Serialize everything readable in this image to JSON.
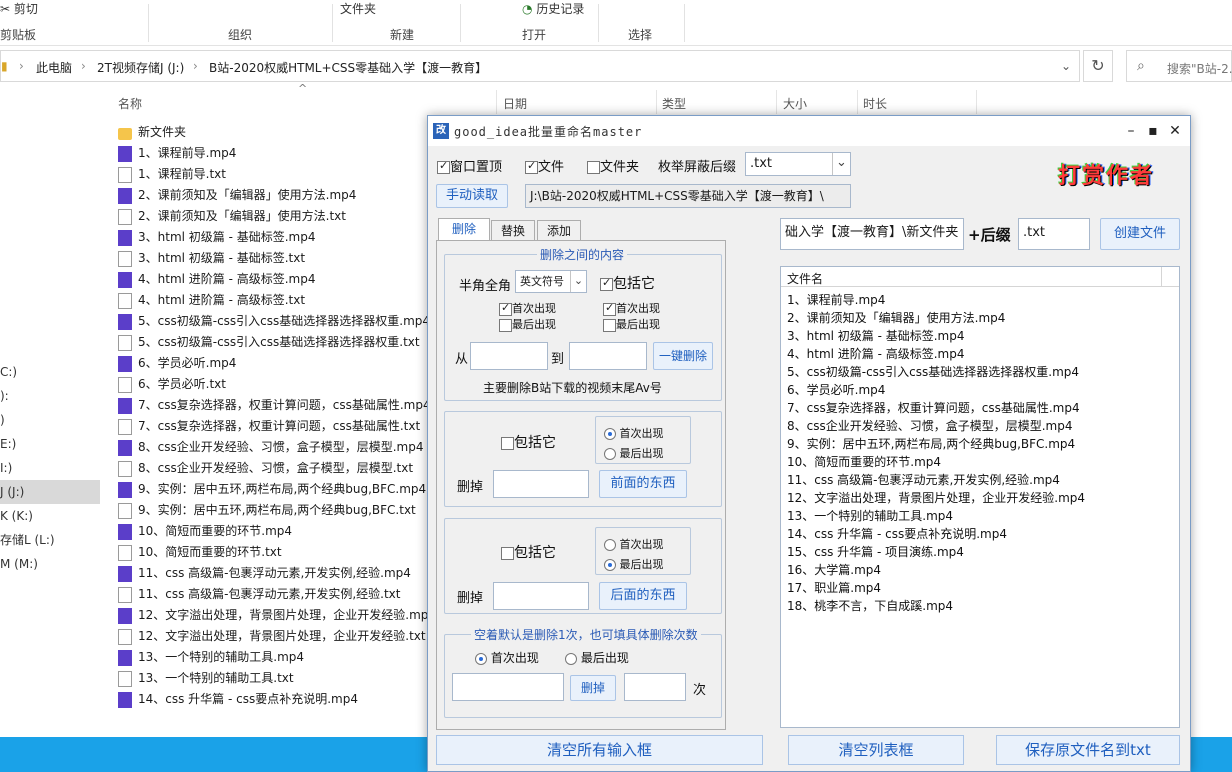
{
  "ribbon": {
    "top_items": [
      {
        "name": "cut",
        "label": "剪切"
      },
      {
        "name": "new-folder",
        "label": "文件夹"
      },
      {
        "name": "history",
        "label": "历史记录"
      }
    ],
    "groups": [
      "剪贴板",
      "组织",
      "新建",
      "打开",
      "选择"
    ]
  },
  "address": {
    "crumbs": [
      "此电脑",
      "2T视频存储J (J:)",
      "B站-2020权威HTML+CSS零基础入学【渡一教育】"
    ],
    "search_placeholder": "搜索\"B站-2..."
  },
  "columns": [
    "名称",
    "日期",
    "类型",
    "大小",
    "时长"
  ],
  "files": [
    {
      "type": "folder",
      "name": "新文件夹"
    },
    {
      "type": "mp4",
      "name": "1、课程前导.mp4"
    },
    {
      "type": "txt",
      "name": "1、课程前导.txt"
    },
    {
      "type": "mp4",
      "name": "2、课前须知及「编辑器」使用方法.mp4"
    },
    {
      "type": "txt",
      "name": "2、课前须知及「编辑器」使用方法.txt"
    },
    {
      "type": "mp4",
      "name": "3、html 初级篇 - 基础标签.mp4"
    },
    {
      "type": "txt",
      "name": "3、html 初级篇 - 基础标签.txt"
    },
    {
      "type": "mp4",
      "name": "4、html 进阶篇 - 高级标签.mp4"
    },
    {
      "type": "txt",
      "name": "4、html 进阶篇 - 高级标签.txt"
    },
    {
      "type": "mp4",
      "name": "5、css初级篇-css引入css基础选择器选择器权重.mp4"
    },
    {
      "type": "txt",
      "name": "5、css初级篇-css引入css基础选择器选择器权重.txt"
    },
    {
      "type": "mp4",
      "name": "6、学员必听.mp4"
    },
    {
      "type": "txt",
      "name": "6、学员必听.txt"
    },
    {
      "type": "mp4",
      "name": "7、css复杂选择器，权重计算问题，css基础属性.mp4"
    },
    {
      "type": "txt",
      "name": "7、css复杂选择器，权重计算问题，css基础属性.txt"
    },
    {
      "type": "mp4",
      "name": "8、css企业开发经验、习惯，盒子模型，层模型.mp4"
    },
    {
      "type": "txt",
      "name": "8、css企业开发经验、习惯，盒子模型，层模型.txt"
    },
    {
      "type": "mp4",
      "name": "9、实例：居中五环,两栏布局,两个经典bug,BFC.mp4"
    },
    {
      "type": "txt",
      "name": "9、实例：居中五环,两栏布局,两个经典bug,BFC.txt"
    },
    {
      "type": "mp4",
      "name": "10、简短而重要的环节.mp4"
    },
    {
      "type": "txt",
      "name": "10、简短而重要的环节.txt"
    },
    {
      "type": "mp4",
      "name": "11、css 高级篇-包裹浮动元素,开发实例,经验.mp4"
    },
    {
      "type": "txt",
      "name": "11、css 高级篇-包裹浮动元素,开发实例,经验.txt"
    },
    {
      "type": "mp4",
      "name": "12、文字溢出处理，背景图片处理，企业开发经验.mp4"
    },
    {
      "type": "txt",
      "name": "12、文字溢出处理，背景图片处理，企业开发经验.txt"
    },
    {
      "type": "mp4",
      "name": "13、一个特别的辅助工具.mp4"
    },
    {
      "type": "txt",
      "name": "13、一个特别的辅助工具.txt"
    },
    {
      "type": "mp4",
      "name": "14、css 升华篇 - css要点补充说明.mp4"
    }
  ],
  "nav": [
    {
      "label": "C:)",
      "selected": false
    },
    {
      "label": "):",
      "selected": false
    },
    {
      "label": ")",
      "selected": false
    },
    {
      "label": "E:)",
      "selected": false
    },
    {
      "label": "I:)",
      "selected": false
    },
    {
      "label": "J (J:)",
      "selected": true
    },
    {
      "label": "K (K:)",
      "selected": false
    },
    {
      "label": "存储L (L:)",
      "selected": false
    },
    {
      "label": "M (M:)",
      "selected": false
    }
  ],
  "dialog": {
    "app_icon": "改",
    "title": "good_idea批量重命名master",
    "controls": {
      "minimize": "–",
      "maximize": "▪",
      "close": "✕"
    },
    "top_row": {
      "window_top_label": "窗口置顶",
      "window_top_checked": true,
      "file_label": "文件",
      "file_checked": true,
      "folder_label": "文件夹",
      "folder_checked": false,
      "suffix_label": "枚举屏蔽后缀",
      "suffix_value": ".txt"
    },
    "reward_label": "打赏作者",
    "manual_read_button": "手动读取",
    "path_value": "J:\\B站-2020权威HTML+CSS零基础入学【渡一教育】\\",
    "tabs": [
      "删除",
      "替换",
      "添加"
    ],
    "delete_between": {
      "title": "删除之间的内容",
      "width_label": "半角全角",
      "symbol_value": "英文符号",
      "include_label": "包括它",
      "include_checked": true,
      "left_first": "首次出现",
      "left_first_checked": true,
      "left_last": "最后出现",
      "left_last_checked": false,
      "right_first": "首次出现",
      "right_first_checked": true,
      "right_last": "最后出现",
      "right_last_checked": false,
      "from_label": "从",
      "to_label": "到",
      "from_value": "",
      "to_value": "",
      "button": "一键删除",
      "hint": "主要删除B站下载的视频末尾Av号"
    },
    "delete_before": {
      "include_label": "包括它",
      "include_checked": false,
      "first_label": "首次出现",
      "first_selected": true,
      "last_label": "最后出现",
      "cut_label": "删掉",
      "value": "",
      "button": "前面的东西"
    },
    "delete_after": {
      "include_label": "包括它",
      "include_checked": false,
      "first_label": "首次出现",
      "last_label": "最后出现",
      "last_selected": true,
      "cut_label": "删掉",
      "value": "",
      "button": "后面的东西"
    },
    "delete_count": {
      "title": "空着默认是删除1次，也可填具体删除次数",
      "first_label": "首次出现",
      "first_selected": true,
      "last_label": "最后出现",
      "value": "",
      "button": "删掉",
      "count_value": "",
      "times_label": "次"
    },
    "create": {
      "path_value": "础入学【渡一教育】\\新文件夹",
      "plus_suffix_label": "+后缀",
      "suffix_value": ".txt",
      "button": "创建文件"
    },
    "list_header": "文件名",
    "list_items": [
      "1、课程前导.mp4",
      "2、课前须知及「编辑器」使用方法.mp4",
      "3、html 初级篇 - 基础标签.mp4",
      "4、html 进阶篇 - 高级标签.mp4",
      "5、css初级篇-css引入css基础选择器选择器权重.mp4",
      "6、学员必听.mp4",
      "7、css复杂选择器，权重计算问题，css基础属性.mp4",
      "8、css企业开发经验、习惯，盒子模型，层模型.mp4",
      "9、实例：居中五环,两栏布局,两个经典bug,BFC.mp4",
      "10、简短而重要的环节.mp4",
      "11、css 高级篇-包裹浮动元素,开发实例,经验.mp4",
      "12、文字溢出处理，背景图片处理，企业开发经验.mp4",
      "13、一个特别的辅助工具.mp4",
      "14、css 升华篇 - css要点补充说明.mp4",
      "15、css 升华篇 - 项目演练.mp4",
      "16、大学篇.mp4",
      "17、职业篇.mp4",
      "18、桃李不言，下自成蹊.mp4"
    ],
    "bottom_buttons": {
      "clear_inputs": "清空所有输入框",
      "clear_list": "清空列表框",
      "save_names": "保存原文件名到txt"
    }
  },
  "colors": {
    "taskbar": "#1aa2e8",
    "accent": "#1f5fbf",
    "mp4_icon": "#5b3ec9",
    "folder_icon": "#f5c54b"
  }
}
